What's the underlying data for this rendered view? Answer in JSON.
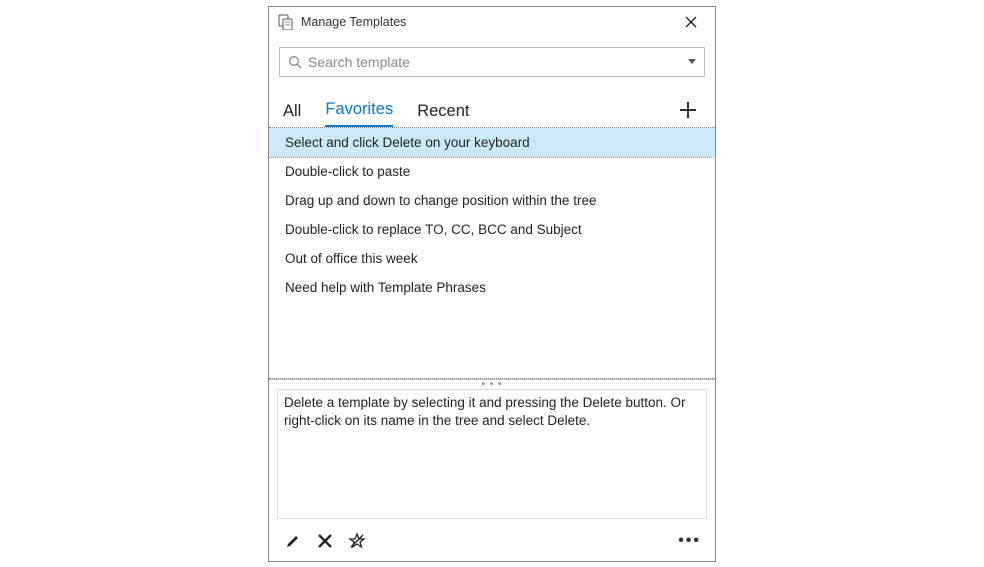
{
  "titlebar": {
    "title": "Manage Templates"
  },
  "search": {
    "placeholder": "Search template"
  },
  "tabs": {
    "items": [
      {
        "label": "All"
      },
      {
        "label": "Favorites"
      },
      {
        "label": "Recent"
      }
    ],
    "active_index": 1
  },
  "templates": {
    "selected_index": 0,
    "items": [
      "Select and click Delete on your keyboard",
      "Double-click to paste",
      "Drag up and down to change position within the tree",
      "Double-click to replace TO, CC, BCC and Subject",
      "Out of office this week",
      "Need help with Template Phrases"
    ]
  },
  "preview": {
    "text": "Delete a template by selecting it and pressing the Delete button. Or right-click on its name in the tree and select Delete."
  },
  "footer": {
    "edit_title": "Edit",
    "delete_title": "Delete",
    "unfavorite_title": "Unfavorite",
    "more_title": "More"
  }
}
